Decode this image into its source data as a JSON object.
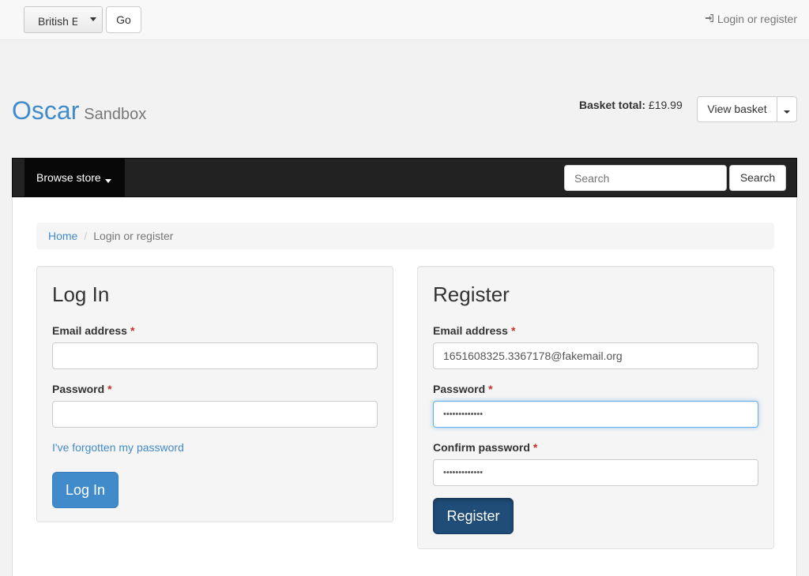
{
  "topbar": {
    "language_value": "British English",
    "go_label": "Go",
    "login_link": "Login or register"
  },
  "header": {
    "brand_name": "Oscar",
    "brand_tagline": "Sandbox",
    "basket_total_label": "Basket total:",
    "basket_total_value": "£19.99",
    "view_basket_label": "View basket"
  },
  "navbar": {
    "browse_store_label": "Browse store",
    "search_placeholder": "Search",
    "search_button_label": "Search"
  },
  "breadcrumb": {
    "home": "Home",
    "separator": "/",
    "current": "Login or register"
  },
  "login": {
    "title": "Log In",
    "email_label": "Email address",
    "email_value": "",
    "password_label": "Password",
    "password_value": "",
    "required_marker": "*",
    "forgot_link": "I've forgotten my password",
    "submit_label": "Log In"
  },
  "register": {
    "title": "Register",
    "email_label": "Email address",
    "email_value": "1651608325.3367178@fakemail.org",
    "password_label": "Password",
    "password_value": "•••••••••••••",
    "confirm_label": "Confirm password",
    "confirm_value": "•••••••••••••",
    "required_marker": "*",
    "submit_label": "Register"
  },
  "colors": {
    "link": "#428bca",
    "primary_button": "#428bca",
    "register_button_active": "#1f4d78",
    "navbar_bg": "#222222",
    "required": "#c9302c"
  }
}
